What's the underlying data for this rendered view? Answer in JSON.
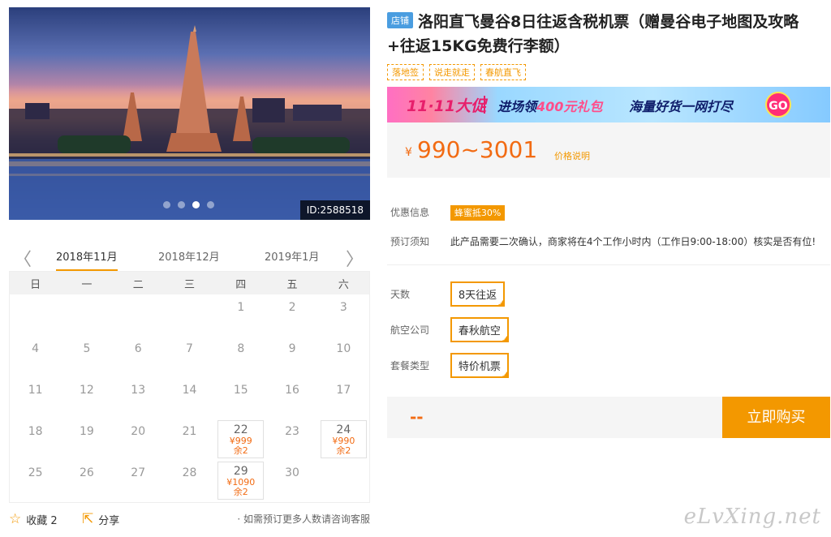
{
  "photo": {
    "id_label": "ID:2588518",
    "slide_count": 4,
    "active_slide": 3
  },
  "calendar": {
    "months": [
      "2018年11月",
      "2018年12月",
      "2019年1月"
    ],
    "active_month": 0,
    "weekdays": [
      "日",
      "一",
      "二",
      "三",
      "四",
      "五",
      "六"
    ],
    "prev_arrow": "〈",
    "next_arrow": "〉",
    "days": [
      {
        "d": ""
      },
      {
        "d": ""
      },
      {
        "d": ""
      },
      {
        "d": ""
      },
      {
        "d": "1"
      },
      {
        "d": "2"
      },
      {
        "d": "3"
      },
      {
        "d": "4"
      },
      {
        "d": "5"
      },
      {
        "d": "6"
      },
      {
        "d": "7"
      },
      {
        "d": "8"
      },
      {
        "d": "9"
      },
      {
        "d": "10"
      },
      {
        "d": "11"
      },
      {
        "d": "12"
      },
      {
        "d": "13"
      },
      {
        "d": "14"
      },
      {
        "d": "15"
      },
      {
        "d": "16"
      },
      {
        "d": "17"
      },
      {
        "d": "18"
      },
      {
        "d": "19"
      },
      {
        "d": "20"
      },
      {
        "d": "21"
      },
      {
        "d": "22",
        "price": "¥999",
        "left": "余2"
      },
      {
        "d": "23"
      },
      {
        "d": "24",
        "price": "¥990",
        "left": "余2"
      },
      {
        "d": "25"
      },
      {
        "d": "26"
      },
      {
        "d": "27"
      },
      {
        "d": "28"
      },
      {
        "d": "29",
        "price": "¥1090",
        "left": "余2"
      },
      {
        "d": "30"
      },
      {
        "d": ""
      }
    ]
  },
  "footer": {
    "favorite_label": "收藏 2",
    "share_label": "分享",
    "note": "· 如需预订更多人数请咨询客服"
  },
  "product": {
    "shop_tag": "店铺",
    "title": "洛阳直飞曼谷8日往返含税机票（赠曼谷电子地图及攻略+往返15KG免费行李额）",
    "tags": [
      "落地签",
      "说走就走",
      "春航直飞"
    ],
    "banner": {
      "left": "11·11大促",
      "mid_a": "进场领",
      "mid_b": "400元礼包",
      "right": "海量好货一网打尽",
      "go": "GO"
    },
    "price_yen": "¥",
    "price_range": "990~3001",
    "price_explain": "价格说明",
    "promo_label": "优惠信息",
    "promo_value": "蜂蜜抵30%",
    "notice_label": "预订须知",
    "notice_text": "此产品需要二次确认，商家将在4个工作小时内（工作日9:00-18:00）核实是否有位!",
    "options": [
      {
        "label": "天数",
        "value": "8天往返"
      },
      {
        "label": "航空公司",
        "value": "春秋航空"
      },
      {
        "label": "套餐类型",
        "value": "特价机票"
      }
    ],
    "total_placeholder": "--",
    "buy_label": "立即购买"
  },
  "watermark": "eLvXing.net",
  "colors": {
    "accent": "#f39800",
    "price": "#f26b13",
    "shop_tag": "#4a9de0"
  }
}
